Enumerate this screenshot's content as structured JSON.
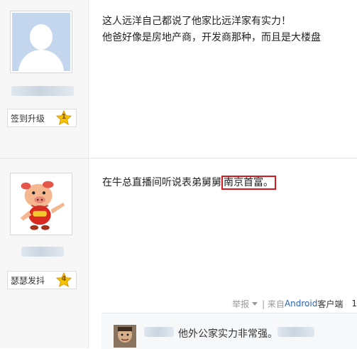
{
  "posts": [
    {
      "level_name": "签到升级",
      "level_number": "1",
      "lines": [
        "这人远洋自己都说了他家比远洋家有实力！",
        "他爸好像是房地产商，开发商那种，而且是大楼盘"
      ]
    },
    {
      "level_name": "瑟瑟发抖",
      "level_number": "4",
      "text_before": "在牛总直播间听说表弟舅舅",
      "text_highlight": "南京首富。",
      "meta": {
        "report": "举报",
        "from": "| 来自",
        "android": "Android",
        "client": "客户端",
        "floor": "1"
      },
      "reply": {
        "text": "他外公家实力非常强。"
      }
    }
  ],
  "colors": {
    "highlight_border": "#d8171c",
    "link": "#2d64b3",
    "star": "#f5c400"
  }
}
